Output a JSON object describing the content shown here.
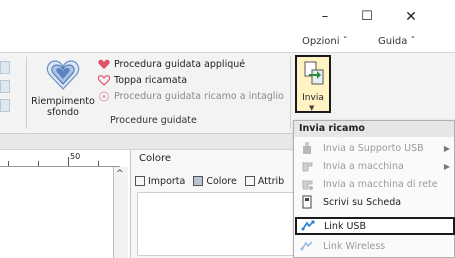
{
  "window": {
    "min_symbol": "–",
    "max_symbol": "☐",
    "close_symbol": "✕"
  },
  "tabs": {
    "opzioni": "Opzioni ˇ",
    "guida": "Guida ˇ"
  },
  "ribbon": {
    "riempimento_label_line1": "Riempimento",
    "riempimento_label_line2": "sfondo",
    "procedures": [
      {
        "label": "Procedura guidata appliqué",
        "enabled": true
      },
      {
        "label": "Toppa ricamata",
        "enabled": true
      },
      {
        "label": "Procedura guidata ricamo a intaglio",
        "enabled": false
      }
    ],
    "group_label": "Procedure guidate",
    "invia_label": "Invia"
  },
  "ruler": {
    "number": "50"
  },
  "panel": {
    "title": "Colore",
    "tabs": [
      "Importa",
      "Colore",
      "Attrib"
    ]
  },
  "menu": {
    "header": "Invia ricamo",
    "items": [
      {
        "label": "Invia a Supporto USB",
        "enabled": false,
        "submenu": true
      },
      {
        "label": "Invia a macchina",
        "enabled": false,
        "submenu": true
      },
      {
        "label": "Invia a macchina di rete",
        "enabled": false,
        "submenu": false
      },
      {
        "label": "Scrivi su Scheda",
        "enabled": true,
        "submenu": false
      },
      {
        "label": "Link USB",
        "enabled": true,
        "highlighted": true,
        "submenu": false
      },
      {
        "label": "Link Wireless",
        "enabled": false,
        "submenu": false
      }
    ]
  },
  "colors": {
    "invia_highlight": "#fff3c4",
    "heart": "#e0506a",
    "accent": "#1a1a1a"
  }
}
